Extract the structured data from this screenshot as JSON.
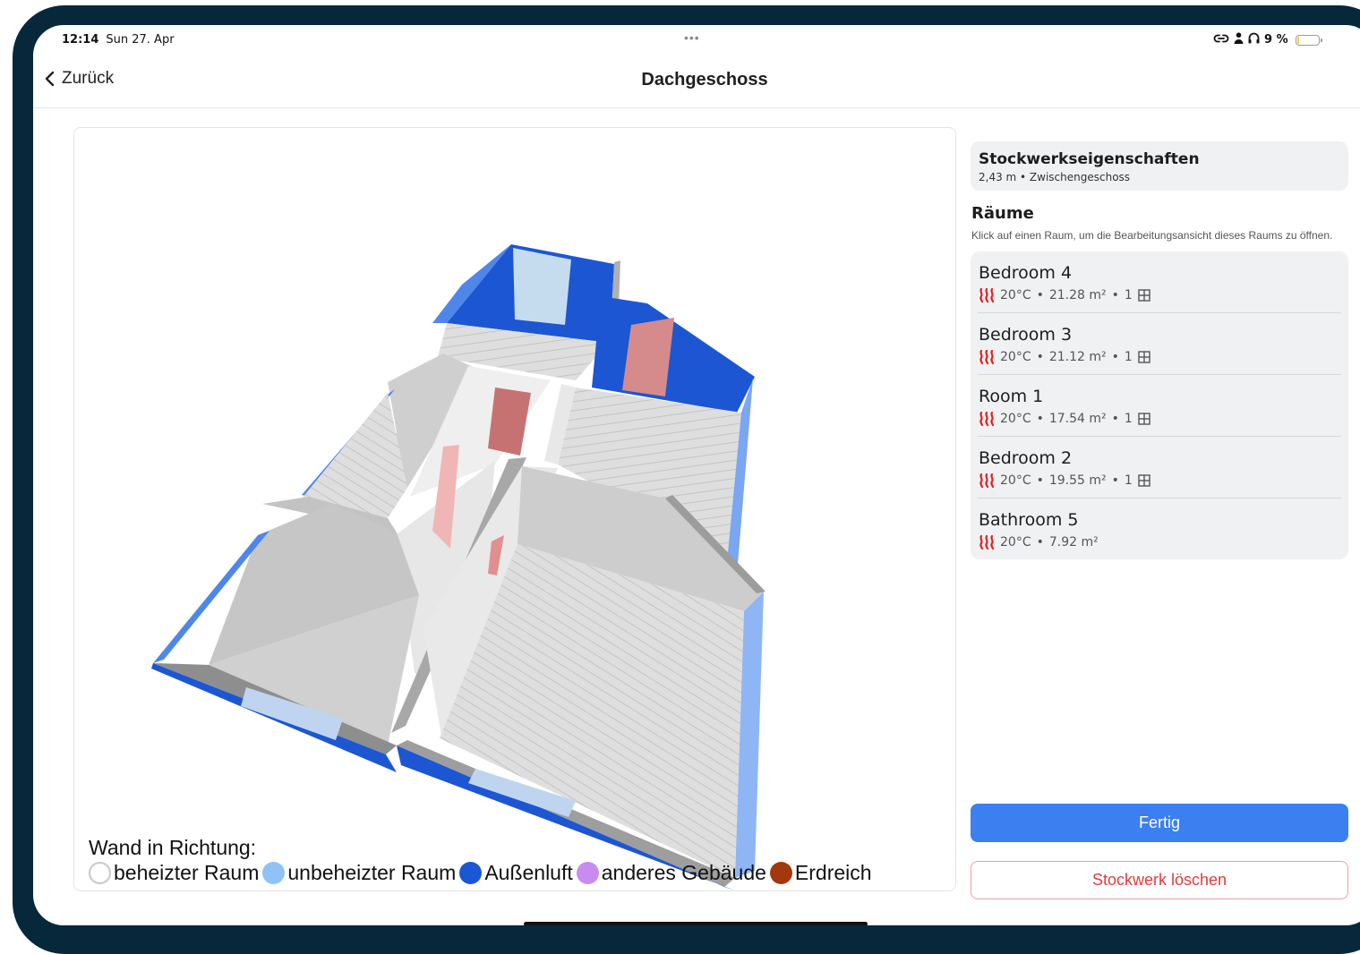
{
  "status_bar": {
    "time": "12:14",
    "date": "Sun 27. Apr",
    "multitask_dots": "•••",
    "battery_text": "9 %",
    "battery_level": 0.09,
    "icons": [
      "link-icon",
      "person-icon",
      "headphones-icon",
      "battery-icon"
    ]
  },
  "nav": {
    "back_label": "Zurück",
    "title": "Dachgeschoss"
  },
  "legend": {
    "title": "Wand in Richtung:",
    "items": [
      {
        "label": "beheizter Raum",
        "color": "#ffffff"
      },
      {
        "label": "unbeheizter Raum",
        "color": "#8fc2f5"
      },
      {
        "label": "Außenluft",
        "color": "#1a56d6"
      },
      {
        "label": "anderes Gebäude",
        "color": "#c88bf0"
      },
      {
        "label": "Erdreich",
        "color": "#a3380e"
      }
    ]
  },
  "floor_properties": {
    "title": "Stockwerkseigenschaften",
    "subtitle": "2,43 m • Zwischengeschoss"
  },
  "rooms_section": {
    "heading": "Räume",
    "hint": " Klick auf einen Raum, um die Bearbeitungsansicht dieses Raums zu öffnen."
  },
  "rooms": [
    {
      "name": "Bedroom 4",
      "temperature": "20°C",
      "area": "21.28 m²",
      "windows": "1"
    },
    {
      "name": "Bedroom 3",
      "temperature": "20°C",
      "area": "21.12 m²",
      "windows": "1"
    },
    {
      "name": "Room 1",
      "temperature": "20°C",
      "area": "17.54 m²",
      "windows": "1"
    },
    {
      "name": "Bedroom 2",
      "temperature": "20°C",
      "area": "19.55 m²",
      "windows": "1"
    },
    {
      "name": "Bathroom 5",
      "temperature": "20°C",
      "area": "7.92 m²",
      "windows": null
    }
  ],
  "meta_separator": "•",
  "buttons": {
    "done": "Fertig",
    "delete_floor": "Stockwerk löschen"
  },
  "colors": {
    "accent": "#3b7ff0",
    "danger": "#e23b3b",
    "exterior_wall": "#1a56d6",
    "interior_wall": "#c9c9c9",
    "heat_icon": "#e02020",
    "bezel": "#06283a"
  }
}
